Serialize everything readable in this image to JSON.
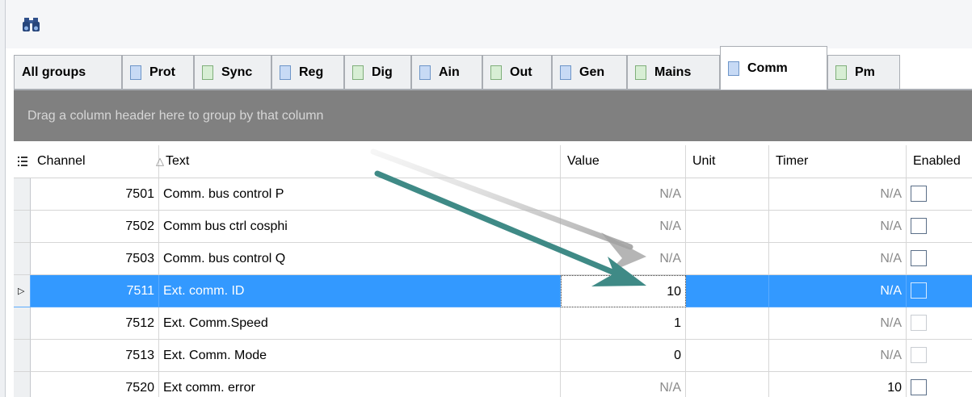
{
  "toolbar": {
    "find_icon": "binoculars-icon"
  },
  "tabs": [
    {
      "label": "All groups",
      "swatch": "none",
      "active": false
    },
    {
      "label": "Prot",
      "swatch": "blue",
      "active": false
    },
    {
      "label": "Sync",
      "swatch": "green",
      "active": false
    },
    {
      "label": "Reg",
      "swatch": "blue",
      "active": false
    },
    {
      "label": "Dig",
      "swatch": "green",
      "active": false
    },
    {
      "label": "Ain",
      "swatch": "blue",
      "active": false
    },
    {
      "label": "Out",
      "swatch": "green",
      "active": false
    },
    {
      "label": "Gen",
      "swatch": "blue",
      "active": false
    },
    {
      "label": "Mains",
      "swatch": "green",
      "active": false
    },
    {
      "label": "Comm",
      "swatch": "blue",
      "active": true
    },
    {
      "label": "Pm",
      "swatch": "green",
      "active": false
    }
  ],
  "group_panel": {
    "hint": "Drag a column header here to group by that column"
  },
  "grid": {
    "columns": {
      "channel": "Channel",
      "text": "Text",
      "value": "Value",
      "unit": "Unit",
      "timer": "Timer",
      "enabled": "Enabled"
    },
    "sort_indicator": "△",
    "rows": [
      {
        "channel": "7501",
        "text": "Comm. bus control P",
        "value": "N/A",
        "unit": "",
        "timer": "N/A",
        "enabled": false,
        "enabled_disabled": false,
        "selected": false
      },
      {
        "channel": "7502",
        "text": "Comm bus ctrl cosphi",
        "value": "N/A",
        "unit": "",
        "timer": "N/A",
        "enabled": false,
        "enabled_disabled": false,
        "selected": false
      },
      {
        "channel": "7503",
        "text": "Comm. bus control Q",
        "value": "N/A",
        "unit": "",
        "timer": "N/A",
        "enabled": false,
        "enabled_disabled": false,
        "selected": false
      },
      {
        "channel": "7511",
        "text": "Ext. comm. ID",
        "value": "10",
        "unit": "",
        "timer": "N/A",
        "enabled": false,
        "enabled_disabled": false,
        "selected": true
      },
      {
        "channel": "7512",
        "text": "Ext. Comm.Speed",
        "value": "1",
        "unit": "",
        "timer": "N/A",
        "enabled": false,
        "enabled_disabled": true,
        "selected": false
      },
      {
        "channel": "7513",
        "text": "Ext. Comm. Mode",
        "value": "0",
        "unit": "",
        "timer": "N/A",
        "enabled": false,
        "enabled_disabled": true,
        "selected": false
      },
      {
        "channel": "7520",
        "text": "Ext comm. error",
        "value": "N/A",
        "unit": "",
        "timer": "10",
        "enabled": false,
        "enabled_disabled": false,
        "selected": false
      }
    ]
  },
  "colors": {
    "selection": "#3399ff",
    "arrow": "#3f8a86",
    "group_panel": "#808080"
  }
}
